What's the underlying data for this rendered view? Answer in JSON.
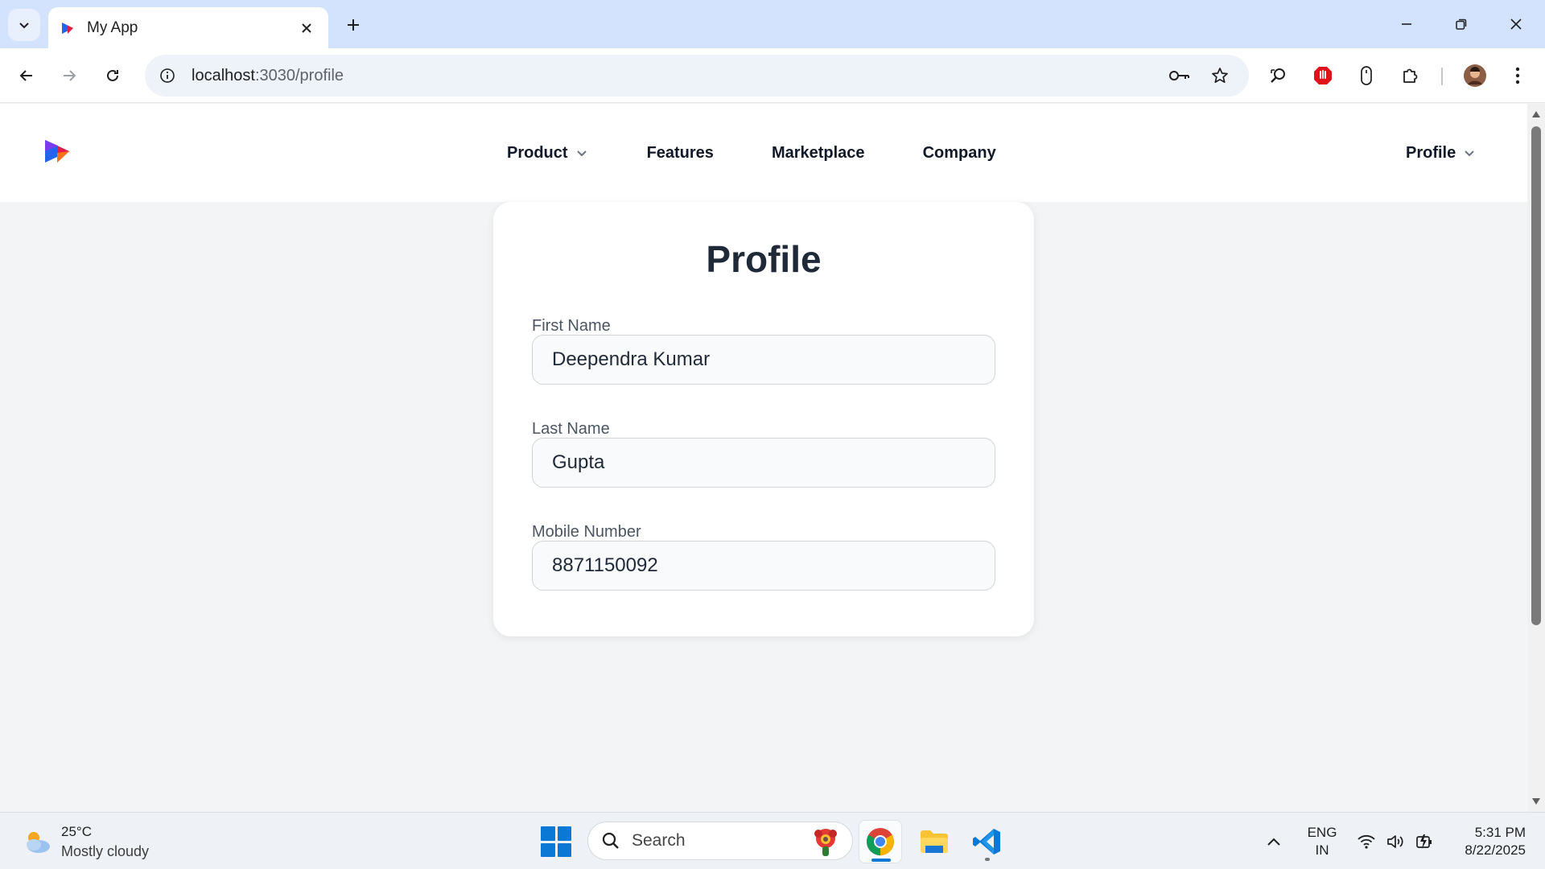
{
  "browser": {
    "tab_title": "My App",
    "url_host": "localhost",
    "url_path": ":3030/profile"
  },
  "nav": {
    "links": [
      {
        "label": "Product",
        "has_dropdown": true
      },
      {
        "label": "Features"
      },
      {
        "label": "Marketplace"
      },
      {
        "label": "Company"
      }
    ],
    "profile_label": "Profile"
  },
  "profile_form": {
    "title": "Profile",
    "fields": [
      {
        "label": "First Name",
        "value": "Deependra Kumar"
      },
      {
        "label": "Last Name",
        "value": "Gupta"
      },
      {
        "label": "Mobile Number",
        "value": "8871150092"
      }
    ]
  },
  "taskbar": {
    "weather_temp": "25°C",
    "weather_condition": "Mostly cloudy",
    "search_label": "Search",
    "language_line1": "ENG",
    "language_line2": "IN",
    "time": "5:31 PM",
    "date": "8/22/2025"
  },
  "colors": {
    "accent": "#0a78d4",
    "page_background": "#f3f4f6",
    "tab_strip": "#d3e3fd"
  }
}
